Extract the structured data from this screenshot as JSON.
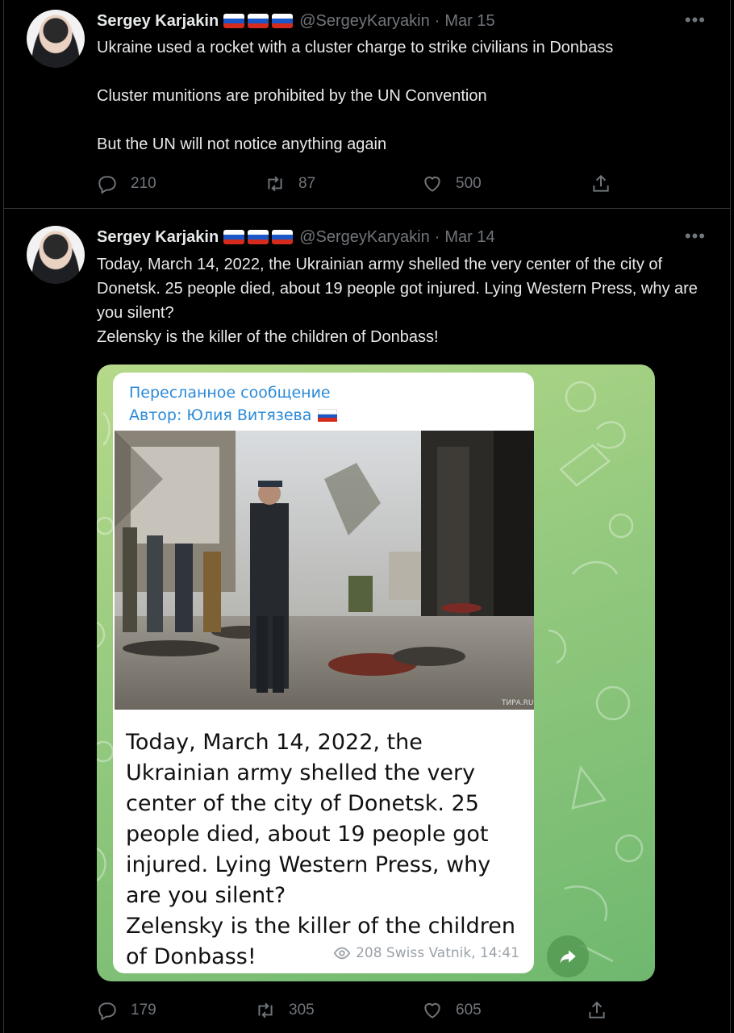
{
  "tweets": [
    {
      "name": "Sergey Karjakin",
      "handle": "@SergeyKaryakin",
      "separator": "·",
      "date": "Mar 15",
      "text": [
        "Ukraine used a rocket with a cluster charge to strike civilians in Donbass",
        "Cluster munitions are prohibited by the UN Convention",
        "But the UN will not notice anything again"
      ],
      "replies": "210",
      "retweets": "87",
      "likes": "500"
    },
    {
      "name": "Sergey Karjakin",
      "handle": "@SergeyKaryakin",
      "separator": "·",
      "date": "Mar 14",
      "text": [
        "Today, March 14, 2022, the Ukrainian army shelled the very center of the city of Donetsk. 25 people died, about 19 people got injured. Lying Western Press, why are you silent?",
        "Zelensky is the killer of the children of Donbass!"
      ],
      "replies": "179",
      "retweets": "305",
      "likes": "605",
      "media": {
        "forwarded_label": "Пересланное сообщение",
        "author_label": "Автор: Юлия Витязева",
        "message_lines": [
          "Today, March 14, 2022, the Ukrainian army shelled the very center of the city of Donetsk. 25 people died, about 19 people got injured. Lying Western Press, why are you silent?",
          "Zelensky is the killer of the children of Donbass!"
        ],
        "meta": "208 Swiss Vatnik, 14:41",
        "photo_watermark": "ТИРА.RU"
      }
    }
  ],
  "icons": {
    "more": "more-icon",
    "reply": "reply-icon",
    "retweet": "retweet-icon",
    "like": "heart-icon",
    "share": "share-icon",
    "views": "eye-icon",
    "forward": "forward-arrow-icon"
  },
  "colors": {
    "background": "#000000",
    "text": "#e7e9ea",
    "muted": "#71767b",
    "divider": "#2f3336",
    "telegram_link": "#2a8ad8"
  }
}
